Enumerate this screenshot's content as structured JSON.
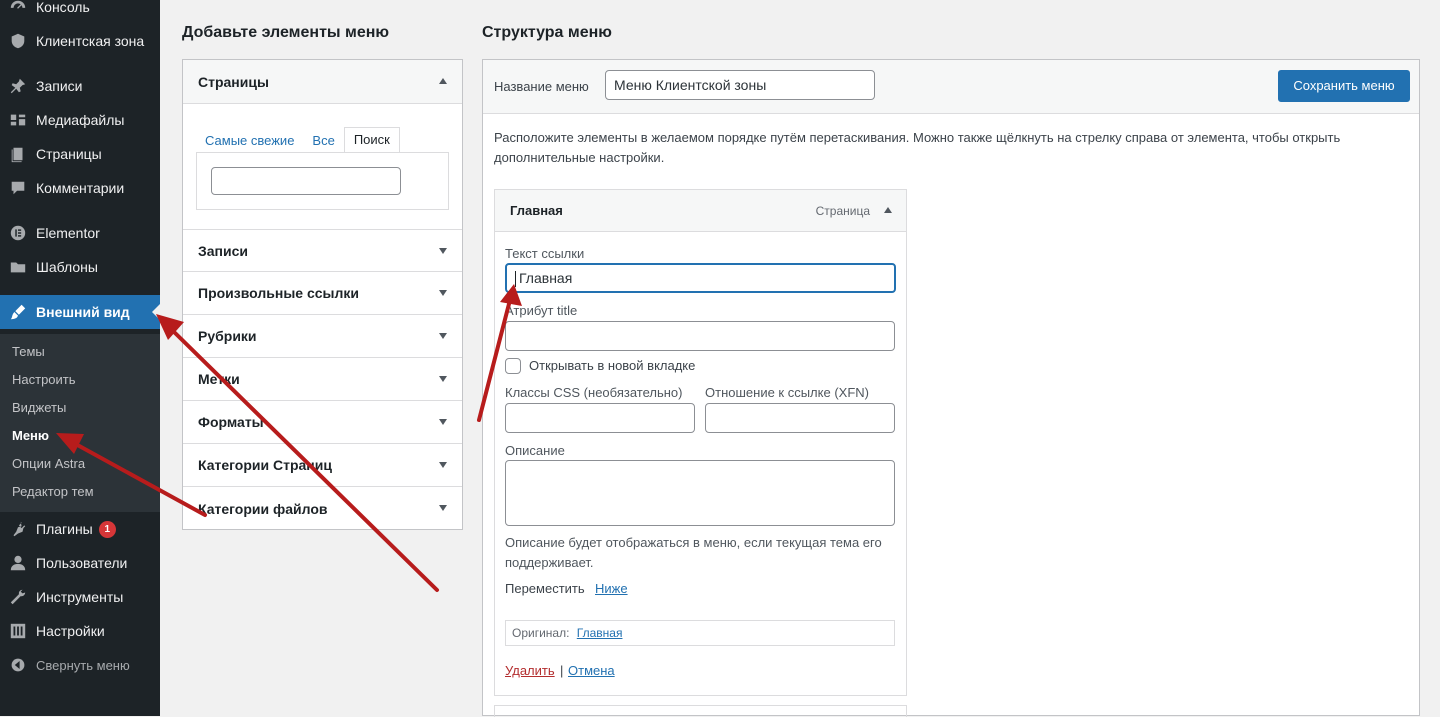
{
  "sidebar": {
    "items": [
      {
        "label": "Консоль",
        "icon": "dashboard-icon"
      },
      {
        "label": "Клиентская зона",
        "icon": "shield-icon"
      },
      {
        "label": "Записи",
        "icon": "pin-icon"
      },
      {
        "label": "Медиафайлы",
        "icon": "media-icon"
      },
      {
        "label": "Страницы",
        "icon": "pages-icon"
      },
      {
        "label": "Комментарии",
        "icon": "comment-icon"
      },
      {
        "label": "Elementor",
        "icon": "elementor-icon"
      },
      {
        "label": "Шаблоны",
        "icon": "folder-icon"
      },
      {
        "label": "Внешний вид",
        "icon": "brush-icon"
      },
      {
        "label": "Плагины",
        "icon": "plugin-icon",
        "badge": "1"
      },
      {
        "label": "Пользователи",
        "icon": "user-icon"
      },
      {
        "label": "Инструменты",
        "icon": "wrench-icon"
      },
      {
        "label": "Настройки",
        "icon": "settings-icon"
      }
    ],
    "submenu": [
      "Темы",
      "Настроить",
      "Виджеты",
      "Меню",
      "Опции Astra",
      "Редактор тем"
    ],
    "collapse_label": "Свернуть меню"
  },
  "add_items": {
    "heading": "Добавьте элементы меню",
    "sections": [
      "Страницы",
      "Записи",
      "Произвольные ссылки",
      "Рубрики",
      "Метки",
      "Форматы",
      "Категории Страниц",
      "Категории файлов"
    ],
    "tabs": [
      "Самые свежие",
      "Все",
      "Поиск"
    ]
  },
  "structure": {
    "heading": "Структура меню",
    "menu_name_label": "Название меню",
    "menu_name_value": "Меню Клиентской зоны",
    "save_label": "Сохранить меню",
    "instructions": "Расположите элементы в желаемом порядке путём перетаскивания. Можно также щёлкнуть на стрелку справа от элемента, чтобы открыть дополнительные настройки.",
    "item": {
      "title": "Главная",
      "type": "Страница",
      "link_text_label": "Текст ссылки",
      "link_text_value": "Главная",
      "title_attr_label": "Атрибут title",
      "new_tab_label": "Открывать в новой вкладке",
      "css_label": "Классы CSS (необязательно)",
      "xfn_label": "Отношение к ссылке (XFN)",
      "description_label": "Описание",
      "description_hint": "Описание будет отображаться в меню, если текущая тема его поддерживает.",
      "move_label": "Переместить",
      "move_down": "Ниже",
      "original_label": "Оригинал:",
      "original_link": "Главная",
      "delete_label": "Удалить",
      "separator": "|",
      "cancel_label": "Отмена"
    }
  },
  "colors": {
    "sidebar_bg": "#1d2327",
    "accent": "#2271b1",
    "annotation_arrow": "#b71c1c"
  }
}
